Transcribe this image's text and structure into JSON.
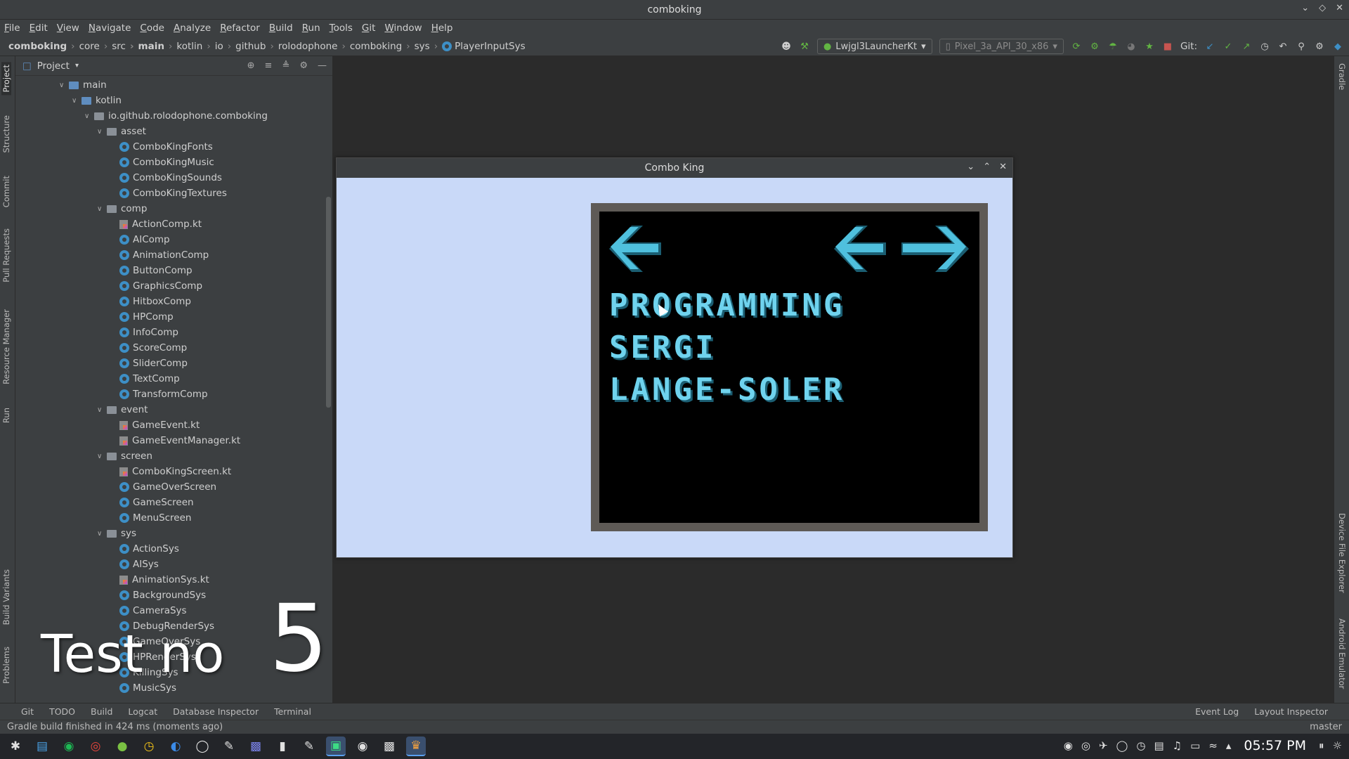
{
  "window": {
    "title": "comboking"
  },
  "menu": [
    "File",
    "Edit",
    "View",
    "Navigate",
    "Code",
    "Analyze",
    "Refactor",
    "Build",
    "Run",
    "Tools",
    "Git",
    "Window",
    "Help"
  ],
  "breadcrumb": [
    "comboking",
    "core",
    "src",
    "main",
    "kotlin",
    "io",
    "github",
    "rolodophone",
    "comboking",
    "sys",
    "PlayerInputSys"
  ],
  "toolbar": {
    "run_config": "Lwjgl3LauncherKt",
    "device": "Pixel_3a_API_30_x86",
    "git_label": "Git:"
  },
  "left_tabs": [
    "Project",
    "Structure",
    "Commit",
    "Pull Requests",
    "Resource Manager",
    "Run",
    "Build Variants",
    "Problems"
  ],
  "right_tabs": [
    "Gradle",
    "Device File Explorer",
    "Android Emulator"
  ],
  "project_panel": {
    "title": "Project"
  },
  "tree": [
    {
      "label": "main",
      "depth": 0,
      "kind": "folder-blue",
      "expanded": true
    },
    {
      "label": "kotlin",
      "depth": 1,
      "kind": "folder-blue",
      "expanded": true
    },
    {
      "label": "io.github.rolodophone.comboking",
      "depth": 2,
      "kind": "folder",
      "expanded": true
    },
    {
      "label": "asset",
      "depth": 3,
      "kind": "folder",
      "expanded": true
    },
    {
      "label": "ComboKingFonts",
      "depth": 4,
      "kind": "class"
    },
    {
      "label": "ComboKingMusic",
      "depth": 4,
      "kind": "class"
    },
    {
      "label": "ComboKingSounds",
      "depth": 4,
      "kind": "class"
    },
    {
      "label": "ComboKingTextures",
      "depth": 4,
      "kind": "class"
    },
    {
      "label": "comp",
      "depth": 3,
      "kind": "folder",
      "expanded": true
    },
    {
      "label": "ActionComp.kt",
      "depth": 4,
      "kind": "kt"
    },
    {
      "label": "AIComp",
      "depth": 4,
      "kind": "class"
    },
    {
      "label": "AnimationComp",
      "depth": 4,
      "kind": "class"
    },
    {
      "label": "ButtonComp",
      "depth": 4,
      "kind": "class"
    },
    {
      "label": "GraphicsComp",
      "depth": 4,
      "kind": "class"
    },
    {
      "label": "HitboxComp",
      "depth": 4,
      "kind": "class"
    },
    {
      "label": "HPComp",
      "depth": 4,
      "kind": "class"
    },
    {
      "label": "InfoComp",
      "depth": 4,
      "kind": "class"
    },
    {
      "label": "ScoreComp",
      "depth": 4,
      "kind": "class"
    },
    {
      "label": "SliderComp",
      "depth": 4,
      "kind": "class"
    },
    {
      "label": "TextComp",
      "depth": 4,
      "kind": "class"
    },
    {
      "label": "TransformComp",
      "depth": 4,
      "kind": "class"
    },
    {
      "label": "event",
      "depth": 3,
      "kind": "folder",
      "expanded": true
    },
    {
      "label": "GameEvent.kt",
      "depth": 4,
      "kind": "kt"
    },
    {
      "label": "GameEventManager.kt",
      "depth": 4,
      "kind": "kt"
    },
    {
      "label": "screen",
      "depth": 3,
      "kind": "folder",
      "expanded": true
    },
    {
      "label": "ComboKingScreen.kt",
      "depth": 4,
      "kind": "kt"
    },
    {
      "label": "GameOverScreen",
      "depth": 4,
      "kind": "class"
    },
    {
      "label": "GameScreen",
      "depth": 4,
      "kind": "class"
    },
    {
      "label": "MenuScreen",
      "depth": 4,
      "kind": "class"
    },
    {
      "label": "sys",
      "depth": 3,
      "kind": "folder",
      "expanded": true
    },
    {
      "label": "ActionSys",
      "depth": 4,
      "kind": "class"
    },
    {
      "label": "AISys",
      "depth": 4,
      "kind": "class"
    },
    {
      "label": "AnimationSys.kt",
      "depth": 4,
      "kind": "kt"
    },
    {
      "label": "BackgroundSys",
      "depth": 4,
      "kind": "class"
    },
    {
      "label": "CameraSys",
      "depth": 4,
      "kind": "class"
    },
    {
      "label": "DebugRenderSys",
      "depth": 4,
      "kind": "class"
    },
    {
      "label": "GameOverSys",
      "depth": 4,
      "kind": "class"
    },
    {
      "label": "HPRenderSys",
      "depth": 4,
      "kind": "class"
    },
    {
      "label": "KillingSys",
      "depth": 4,
      "kind": "class"
    },
    {
      "label": "MusicSys",
      "depth": 4,
      "kind": "class"
    }
  ],
  "game_window": {
    "title": "Combo King",
    "lines": [
      "PROGRAMMING",
      "SERGI",
      "LANGE-SOLER"
    ]
  },
  "bottom_tabs": [
    "Git",
    "TODO",
    "Build",
    "Logcat",
    "Database Inspector",
    "Terminal"
  ],
  "bottom_right_tabs": [
    "Event Log",
    "Layout Inspector"
  ],
  "status": {
    "message": "Gradle build finished in 424 ms (moments ago)",
    "branch": "master"
  },
  "overlay": {
    "text": "Test no",
    "number": "5"
  },
  "taskbar": {
    "clock": "05:57 PM"
  },
  "colors": {
    "game_bg": "#c9d9f8",
    "pixel_text": "#6fd3ee",
    "ide_bg": "#2b2b2b",
    "panel_bg": "#3c3f41"
  }
}
